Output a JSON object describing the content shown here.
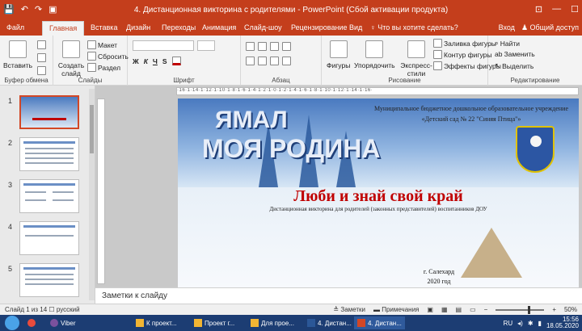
{
  "window": {
    "title": "4. Дистанционная викторина с родителями - PowerPoint (Сбой активации продукта)",
    "quick_access": [
      "💾",
      "↶",
      "↷",
      "▣"
    ],
    "controls": [
      "⊡",
      "—",
      "☐"
    ]
  },
  "tabs": [
    "Файл",
    "Главная",
    "Вставка",
    "Дизайн",
    "Переходы",
    "Анимация",
    "Слайд-шоу",
    "Рецензирование",
    "Вид",
    "Что вы хотите сделать?"
  ],
  "tabs_right": {
    "signin": "Вход",
    "share": "Общий доступ"
  },
  "ribbon": {
    "clipboard": {
      "paste": "Вставить",
      "label": "Буфер обмена"
    },
    "slides": {
      "create": "Создать слайд",
      "layout": "Макет",
      "reset": "Сбросить",
      "section": "Раздел",
      "label": "Слайды"
    },
    "font": {
      "bold": "Ж",
      "italic": "К",
      "underline": "Ч",
      "strike": "S",
      "label": "Шрифт"
    },
    "paragraph": {
      "label": "Абзац"
    },
    "drawing": {
      "shapes": "Фигуры",
      "arrange": "Упорядочить",
      "styles": "Экспресс-стили",
      "fill": "Заливка фигуры",
      "outline": "Контур фигуры",
      "effects": "Эффекты фигуры",
      "label": "Рисование"
    },
    "editing": {
      "find": "Найти",
      "replace": "Заменить",
      "select": "Выделить",
      "label": "Редактирование"
    }
  },
  "thumbnails": [
    {
      "num": "1",
      "selected": true
    },
    {
      "num": "2",
      "selected": false
    },
    {
      "num": "3",
      "selected": false
    },
    {
      "num": "4",
      "selected": false
    },
    {
      "num": "5",
      "selected": false
    }
  ],
  "slide": {
    "big_line1": "ЯМАЛ",
    "big_line2": "МОЯ РОДИНА",
    "org_line1": "Муниципальное бюджетное дошкольное образовательное учреждение",
    "org_line2": "«Детский сад № 22 \"Синяя Птица\"»",
    "headline": "Люби и знай свой край",
    "subtitle": "Дистанционная викторина для родителей (законных представителей) воспитанников ДОУ",
    "city": "г. Салехард",
    "year": "2020 год"
  },
  "notes": {
    "placeholder": "Заметки к слайду"
  },
  "status": {
    "slide_info": "Слайд 1 из 14",
    "language": "русский",
    "notes_btn": "Заметки",
    "comments_btn": "Примечания",
    "zoom": "50%"
  },
  "taskbar": {
    "items": [
      "Viber",
      "К проект...",
      "Проект г...",
      "Для прое...",
      "4. Дистан...",
      "4. Дистан..."
    ],
    "active_index": 5,
    "lang": "RU",
    "time": "15:56",
    "date": "18.05.2020"
  },
  "colors": {
    "accent": "#c43e1c",
    "headline": "#c00000",
    "taskbar": "#1c3d73"
  }
}
